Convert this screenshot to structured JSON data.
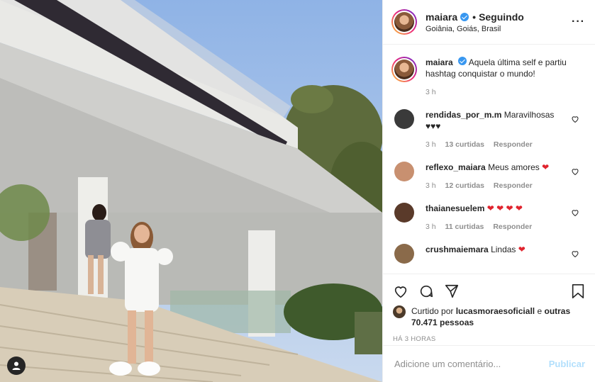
{
  "header": {
    "username": "maiara",
    "follow_status": "Seguindo",
    "dot": "•",
    "location": "Goiânia, Goiás, Brasil"
  },
  "caption": {
    "username": "maiara",
    "text": "Aquela última self e partiu hashtag conquistar o mundo!",
    "time": "3 h"
  },
  "comments": [
    {
      "username": "rendidas_por_m.m",
      "text": "Maravilhosas",
      "extra": "♥♥♥",
      "time": "3 h",
      "likes": "13 curtidas",
      "reply": "Responder",
      "avatar_color": "#3a3a3a"
    },
    {
      "username": "reflexo_maiara",
      "text": "Meus amores",
      "extra": "❤",
      "time": "3 h",
      "likes": "12 curtidas",
      "reply": "Responder",
      "avatar_color": "#c89070"
    },
    {
      "username": "thaianesuelem",
      "text": "",
      "extra": "❤ ❤ ❤ ❤",
      "time": "3 h",
      "likes": "11 curtidas",
      "reply": "Responder",
      "avatar_color": "#5a3a2a"
    },
    {
      "username": "crushmaiemara",
      "text": "Lindas",
      "extra": "❤",
      "avatar_color": "#8a6a4a"
    }
  ],
  "likes": {
    "prefix": "Curtido por",
    "user": "lucasmoraesoficiall",
    "and": "e",
    "others": "outras 70.471 pessoas"
  },
  "timestamp": "HÁ 3 HORAS",
  "comment_box": {
    "placeholder": "Adicione um comentário...",
    "publish": "Publicar"
  },
  "icons": [
    "heart-icon",
    "comment-icon",
    "share-icon",
    "save-icon",
    "more-icon",
    "tag-user-icon"
  ],
  "colors": {
    "verified": "#3897f0",
    "publish": "#b2dffc",
    "heart": "#e0242e",
    "muted": "#8e8e8e"
  }
}
